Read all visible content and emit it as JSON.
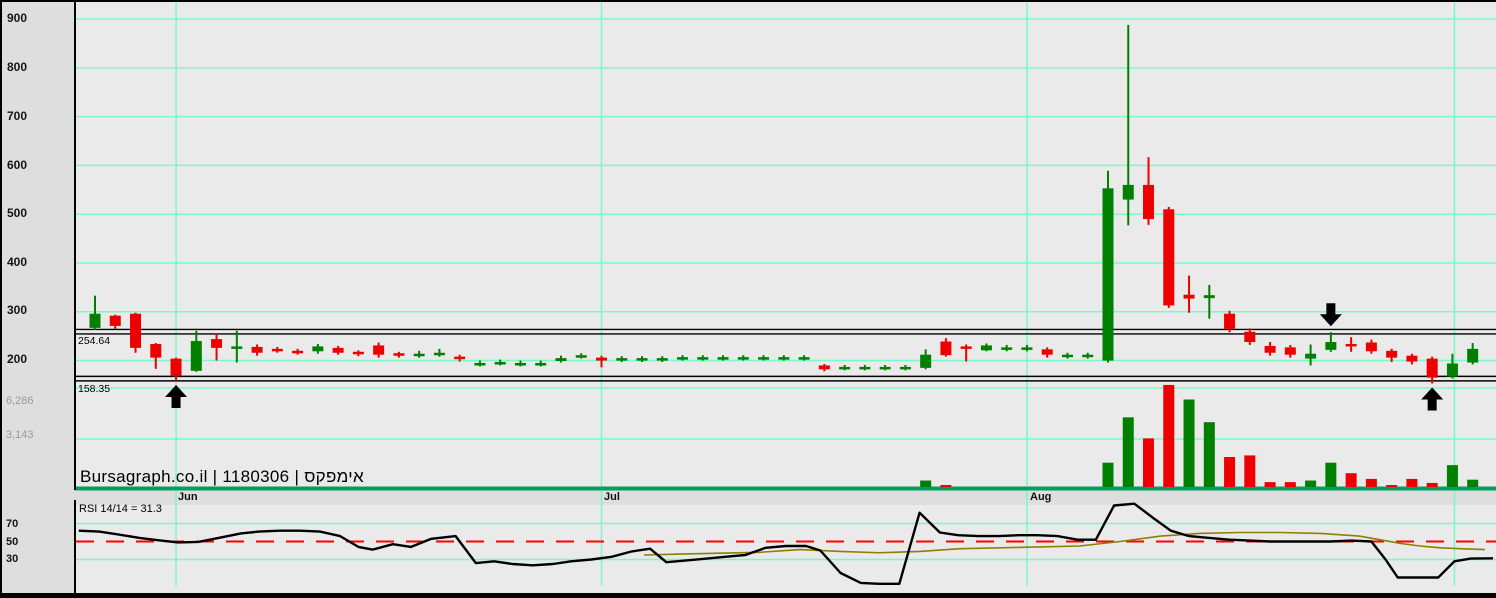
{
  "window": {
    "watermark": "Bursagraph.co.il | 1180306 | אימפקס"
  },
  "colors": {
    "up": "#008000",
    "down": "#ee0000",
    "grid": "#79f9c7",
    "page_bg": "#dedede",
    "plot_bg": "#eaeaea",
    "panel_border_green": "#009e5f",
    "level_line": "#000000",
    "rsi_line": "#000000",
    "rsi_signal": "#8b8000",
    "rsi_midline_red": "#ff0000",
    "volume_label_gray": "#9a9a9a",
    "arrow_black": "#000000"
  },
  "price_axis": {
    "labels": [
      "900",
      "800",
      "700",
      "600",
      "500",
      "400",
      "300",
      "200"
    ]
  },
  "volume_axis": {
    "labels": [
      "6,286",
      "3,143"
    ]
  },
  "x_axis": {
    "months": [
      "Jun",
      "Jul",
      "Aug"
    ]
  },
  "levels": [
    {
      "label": "254.64"
    },
    {
      "label": "158.35"
    }
  ],
  "rsi_panel": {
    "title": "RSI 14/14 = 31.3",
    "axis_labels": [
      "70",
      "50",
      "30"
    ]
  },
  "chart_data": {
    "type": "candlestick",
    "title": "Bursagraph.co.il | 1180306 | אימפקס",
    "price_gridlines": [
      900,
      800,
      700,
      600,
      500,
      400,
      300,
      200
    ],
    "price_ylim_visible": [
      140,
      905
    ],
    "volume_gridlines": [
      6286,
      3143
    ],
    "level_lines": [
      254.64,
      158.35
    ],
    "months": [
      {
        "label": "Jun",
        "candle_index": 4
      },
      {
        "label": "Jul",
        "candle_index": 25
      },
      {
        "label": "Aug",
        "candle_index": 46
      }
    ],
    "minor_vertical_indices": [
      67.1
    ],
    "candle_format": [
      "open",
      "high",
      "low",
      "close",
      "volume"
    ],
    "candles": [
      [
        267,
        333,
        263,
        296,
        0
      ],
      [
        292,
        294,
        265,
        271,
        0
      ],
      [
        296,
        298,
        216,
        226,
        0
      ],
      [
        234,
        236,
        183,
        206,
        0
      ],
      [
        204,
        206,
        158,
        169,
        0
      ],
      [
        179,
        261,
        177,
        240,
        0
      ],
      [
        244,
        255,
        200,
        226,
        0
      ],
      [
        224,
        261,
        196,
        229,
        0
      ],
      [
        228,
        233,
        210,
        216,
        0
      ],
      [
        224,
        228,
        216,
        220,
        0
      ],
      [
        220,
        224,
        212,
        216,
        0
      ],
      [
        219,
        234,
        214,
        229,
        0
      ],
      [
        226,
        230,
        212,
        216,
        0
      ],
      [
        218,
        221,
        209,
        213,
        0
      ],
      [
        231,
        237,
        206,
        212,
        0
      ],
      [
        215,
        218,
        206,
        210,
        0
      ],
      [
        210,
        220,
        206,
        214,
        0
      ],
      [
        212,
        224,
        208,
        216,
        0
      ],
      [
        208,
        212,
        198,
        204,
        0
      ],
      [
        191,
        200,
        188,
        195,
        0
      ],
      [
        193,
        202,
        190,
        197,
        0
      ],
      [
        191,
        200,
        188,
        195,
        0
      ],
      [
        191,
        200,
        188,
        195,
        0
      ],
      [
        199,
        210,
        196,
        205,
        0
      ],
      [
        207,
        215,
        204,
        211,
        0
      ],
      [
        206,
        210,
        186,
        200,
        0
      ],
      [
        201,
        209,
        197,
        205,
        0
      ],
      [
        201,
        209,
        197,
        205,
        0
      ],
      [
        201,
        209,
        197,
        205,
        0
      ],
      [
        203,
        211,
        200,
        207,
        0
      ],
      [
        203,
        211,
        200,
        207,
        0
      ],
      [
        203,
        211,
        200,
        207,
        0
      ],
      [
        203,
        211,
        200,
        207,
        0
      ],
      [
        203,
        211,
        200,
        207,
        0
      ],
      [
        203,
        211,
        200,
        207,
        0
      ],
      [
        203,
        211,
        200,
        207,
        0
      ],
      [
        190,
        193,
        178,
        182,
        0
      ],
      [
        183,
        191,
        180,
        187,
        0
      ],
      [
        183,
        191,
        180,
        187,
        0
      ],
      [
        183,
        191,
        180,
        187,
        0
      ],
      [
        183,
        191,
        180,
        187,
        0
      ],
      [
        185,
        223,
        182,
        212,
        400
      ],
      [
        239,
        246,
        208,
        211,
        80
      ],
      [
        229,
        233,
        198,
        224,
        0
      ],
      [
        221,
        235,
        219,
        231,
        0
      ],
      [
        223,
        232,
        219,
        227,
        0
      ],
      [
        223,
        232,
        219,
        227,
        0
      ],
      [
        223,
        227,
        206,
        212,
        0
      ],
      [
        208,
        216,
        204,
        212,
        0
      ],
      [
        208,
        216,
        204,
        212,
        0
      ],
      [
        200,
        589,
        196,
        553,
        1500
      ],
      [
        530,
        888,
        477,
        560,
        4300
      ],
      [
        560,
        617,
        478,
        490,
        3000
      ],
      [
        510,
        515,
        308,
        313,
        6300
      ],
      [
        335,
        374,
        298,
        327,
        5400
      ],
      [
        328,
        355,
        286,
        334,
        4000
      ],
      [
        296,
        302,
        258,
        265,
        1850
      ],
      [
        259,
        266,
        232,
        238,
        1950
      ],
      [
        230,
        238,
        210,
        216,
        300
      ],
      [
        227,
        232,
        206,
        212,
        300
      ],
      [
        204,
        233,
        190,
        214,
        400
      ],
      [
        222,
        258,
        218,
        238,
        1500
      ],
      [
        234,
        248,
        218,
        229,
        850
      ],
      [
        237,
        243,
        214,
        219,
        500
      ],
      [
        220,
        224,
        197,
        206,
        80
      ],
      [
        210,
        214,
        192,
        198,
        500
      ],
      [
        204,
        208,
        153,
        165,
        250
      ],
      [
        167,
        214,
        163,
        194,
        1350
      ],
      [
        196,
        236,
        192,
        224,
        450
      ]
    ],
    "rsi": {
      "label": "RSI 14/14 = 31.3",
      "period": "14/14",
      "last_value": 31.3,
      "levels": [
        70,
        30
      ],
      "midline": 50,
      "series": [
        [
          -0.8,
          62
        ],
        [
          0.2,
          61
        ],
        [
          1.1,
          58
        ],
        [
          2.2,
          54
        ],
        [
          3.1,
          51.5
        ],
        [
          4.1,
          49
        ],
        [
          5.1,
          49.5
        ],
        [
          6.1,
          54
        ],
        [
          7.2,
          59
        ],
        [
          8.1,
          61
        ],
        [
          9.1,
          62
        ],
        [
          10.1,
          62
        ],
        [
          11.1,
          61
        ],
        [
          12.1,
          56
        ],
        [
          13,
          44
        ],
        [
          13.7,
          41
        ],
        [
          14.7,
          47
        ],
        [
          15.6,
          44
        ],
        [
          16.6,
          53
        ],
        [
          17.8,
          56
        ],
        [
          18.8,
          26
        ],
        [
          19.7,
          28
        ],
        [
          20.6,
          25
        ],
        [
          21.6,
          23.5
        ],
        [
          22.6,
          25
        ],
        [
          23.5,
          28
        ],
        [
          24.5,
          30
        ],
        [
          25.5,
          33
        ],
        [
          26.5,
          39
        ],
        [
          27.4,
          42
        ],
        [
          28.2,
          27
        ],
        [
          29.2,
          29
        ],
        [
          30.2,
          31
        ],
        [
          31.1,
          33
        ],
        [
          32.1,
          35
        ],
        [
          33.1,
          43
        ],
        [
          34.1,
          45
        ],
        [
          35.1,
          45
        ],
        [
          35.8,
          40
        ],
        [
          36.8,
          15
        ],
        [
          37.8,
          4
        ],
        [
          38.7,
          3
        ],
        [
          39.7,
          3
        ],
        [
          40.7,
          82
        ],
        [
          41.7,
          60
        ],
        [
          42.6,
          57
        ],
        [
          43.6,
          56
        ],
        [
          44.6,
          56
        ],
        [
          45.6,
          57
        ],
        [
          46.5,
          57
        ],
        [
          47.5,
          56
        ],
        [
          48.5,
          52
        ],
        [
          49.4,
          52
        ],
        [
          50.3,
          90
        ],
        [
          51.3,
          92
        ],
        [
          52.3,
          75
        ],
        [
          53.1,
          62
        ],
        [
          54,
          56
        ],
        [
          55,
          54
        ],
        [
          56,
          52
        ],
        [
          57,
          51
        ],
        [
          58,
          50
        ],
        [
          59,
          50
        ],
        [
          60,
          50
        ],
        [
          61,
          50
        ],
        [
          62,
          51
        ],
        [
          63,
          50
        ],
        [
          63.7,
          30
        ],
        [
          64.3,
          10
        ],
        [
          65.4,
          10
        ],
        [
          66.3,
          10
        ],
        [
          67.1,
          28
        ],
        [
          67.9,
          31
        ],
        [
          69,
          31.3
        ]
      ],
      "signal_series": [
        [
          27.1,
          35
        ],
        [
          28.9,
          36
        ],
        [
          30.8,
          37
        ],
        [
          32.8,
          38
        ],
        [
          34.8,
          41
        ],
        [
          36.8,
          39
        ],
        [
          38.7,
          37.5
        ],
        [
          40.7,
          39
        ],
        [
          42.7,
          42
        ],
        [
          44.7,
          43
        ],
        [
          46.6,
          44
        ],
        [
          48.6,
          45
        ],
        [
          50.6,
          50
        ],
        [
          52.6,
          56
        ],
        [
          54.5,
          59
        ],
        [
          56.5,
          60
        ],
        [
          58.5,
          60
        ],
        [
          60.5,
          59
        ],
        [
          62.4,
          56
        ],
        [
          63.4,
          52
        ],
        [
          64.4,
          48
        ],
        [
          65.4,
          45
        ],
        [
          66.4,
          43
        ],
        [
          67.4,
          42
        ],
        [
          68.6,
          41
        ]
      ]
    },
    "arrows": [
      {
        "dir": "up",
        "candle": 4
      },
      {
        "dir": "down",
        "candle": 61
      },
      {
        "dir": "up",
        "candle": 66
      }
    ]
  }
}
